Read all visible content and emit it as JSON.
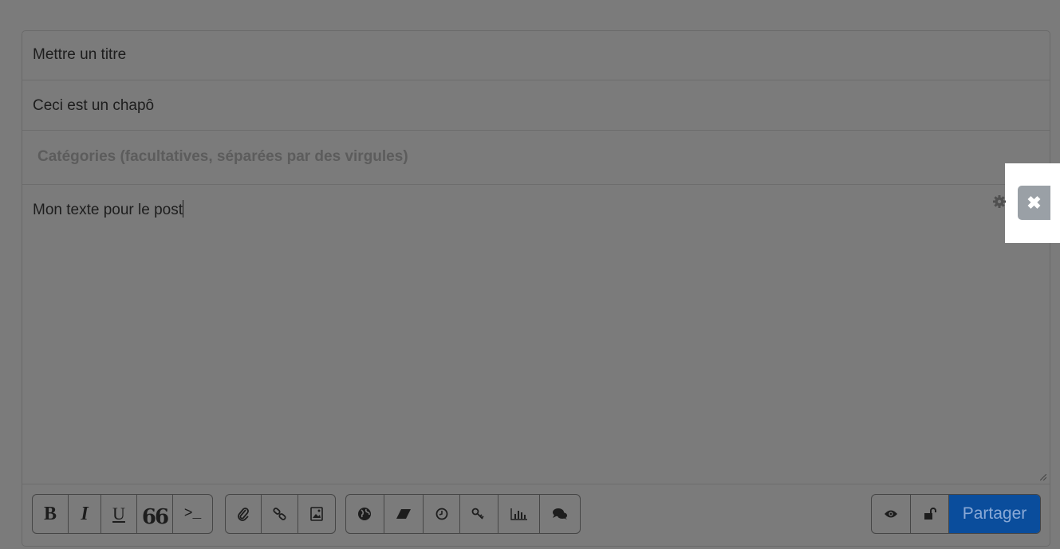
{
  "form": {
    "title_value": "Mettre un titre",
    "chapo_value": "Ceci est un chapô",
    "categories_placeholder": "Catégories (facultatives, séparées par des virgules)",
    "body_value": "Mon texte pour le post"
  },
  "toolbar": {
    "format": {
      "bold": "B",
      "italic": "I",
      "underline": "U",
      "quote": "66",
      "code": ">_"
    },
    "icons": [
      "paperclip-icon",
      "link-icon",
      "image-icon",
      "globe-icon",
      "eraser-icon",
      "clock-icon",
      "key-icon",
      "chart-icon",
      "comments-icon",
      "eye-icon",
      "unlock-icon",
      "gear-icon",
      "close-icon"
    ],
    "submit_label": "Partager"
  },
  "colors": {
    "overlay_bg": "#7b7b7b",
    "submit_bg": "#0a4d9c",
    "close_bg": "#9aa0a6"
  }
}
